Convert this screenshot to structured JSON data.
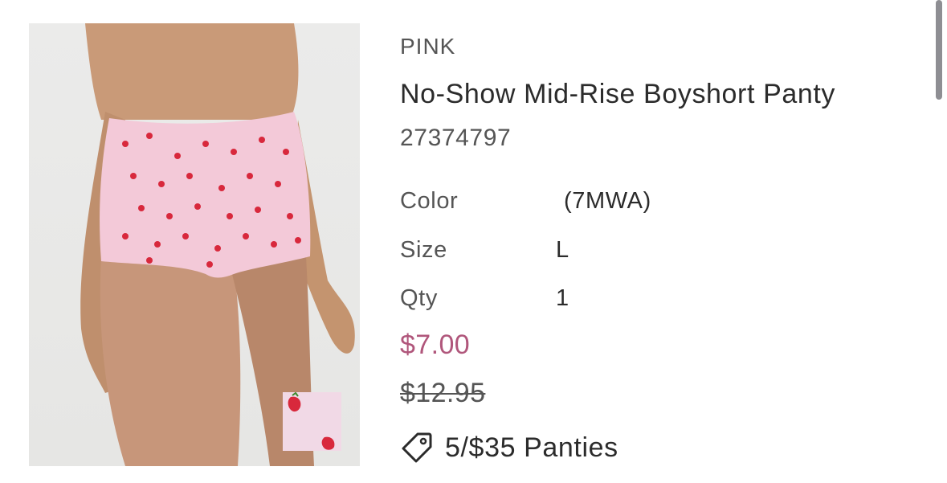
{
  "product": {
    "brand": "PINK",
    "title": "No-Show Mid-Rise Boyshort Panty",
    "sku": "27374797",
    "attributes": {
      "color_label": "Color",
      "color_value": "(7MWA)",
      "size_label": "Size",
      "size_value": "L",
      "qty_label": "Qty",
      "qty_value": "1"
    },
    "sale_price": "$7.00",
    "original_price": "$12.95",
    "promo": "5/$35 Panties",
    "colors": {
      "sale": "#b0567b",
      "fabric": "#f3c9d8",
      "print": "#d8283c"
    },
    "icons": {
      "promo": "tag-icon"
    }
  }
}
